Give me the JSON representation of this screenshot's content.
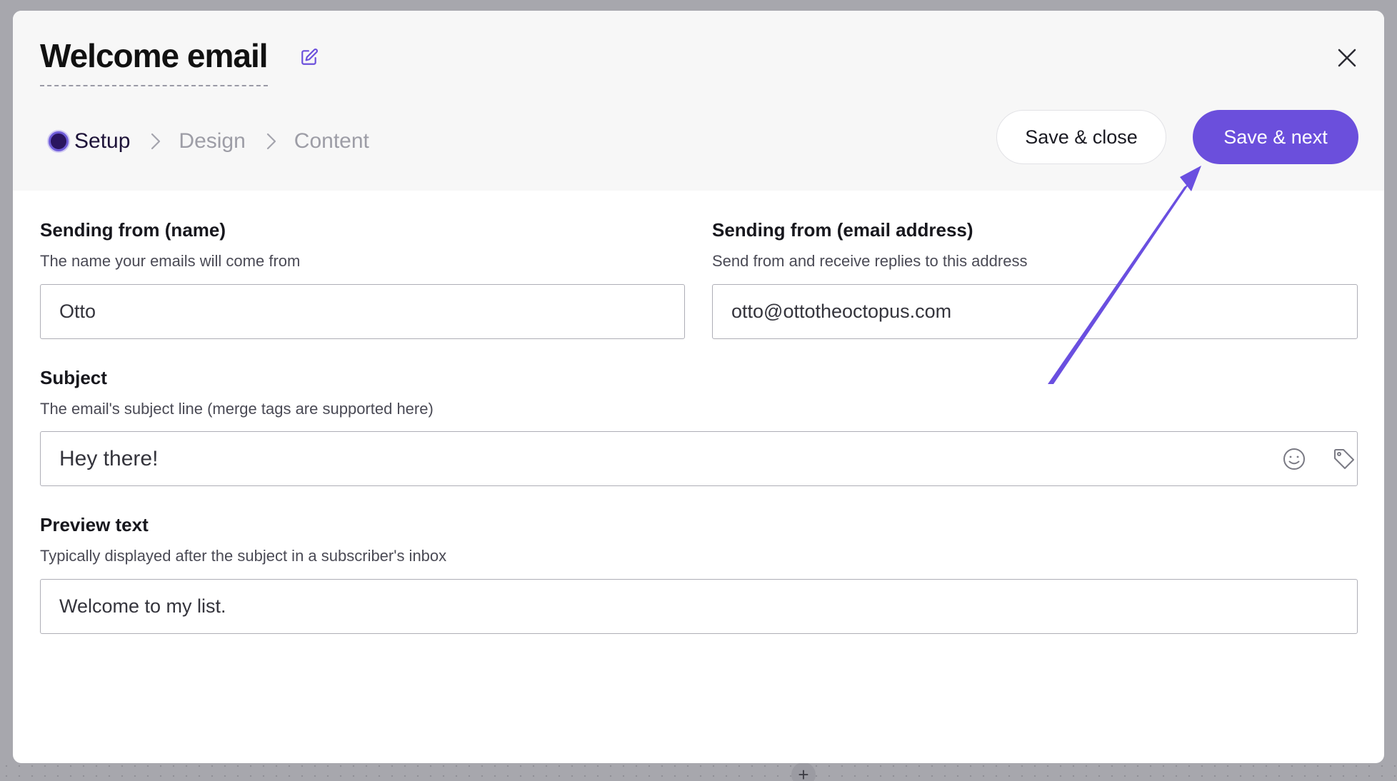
{
  "modal": {
    "title": "Welcome email",
    "steps": [
      {
        "label": "Setup",
        "active": true
      },
      {
        "label": "Design",
        "active": false
      },
      {
        "label": "Content",
        "active": false
      }
    ],
    "buttons": {
      "save_close": "Save & close",
      "save_next": "Save & next"
    }
  },
  "form": {
    "from_name": {
      "label": "Sending from (name)",
      "help": "The name your emails will come from",
      "value": "Otto"
    },
    "from_email": {
      "label": "Sending from (email address)",
      "help": "Send from and receive replies to this address",
      "value": "otto@ottotheoctopus.com"
    },
    "subject": {
      "label": "Subject",
      "help": "The email's subject line (merge tags are supported here)",
      "value": "Hey there!"
    },
    "preview_text": {
      "label": "Preview text",
      "help": "Typically displayed after the subject in a subscriber's inbox",
      "value": "Welcome to my list."
    }
  },
  "icons": [
    "edit-icon",
    "close-icon",
    "emoji-icon",
    "tag-icon",
    "chevron-right-icon",
    "plus-icon"
  ],
  "colors": {
    "accent": "#6b4fdc",
    "header_bg": "#f7f7f7",
    "backdrop": "#a7a7ad",
    "annotation_arrow": "#6a4fe0"
  }
}
